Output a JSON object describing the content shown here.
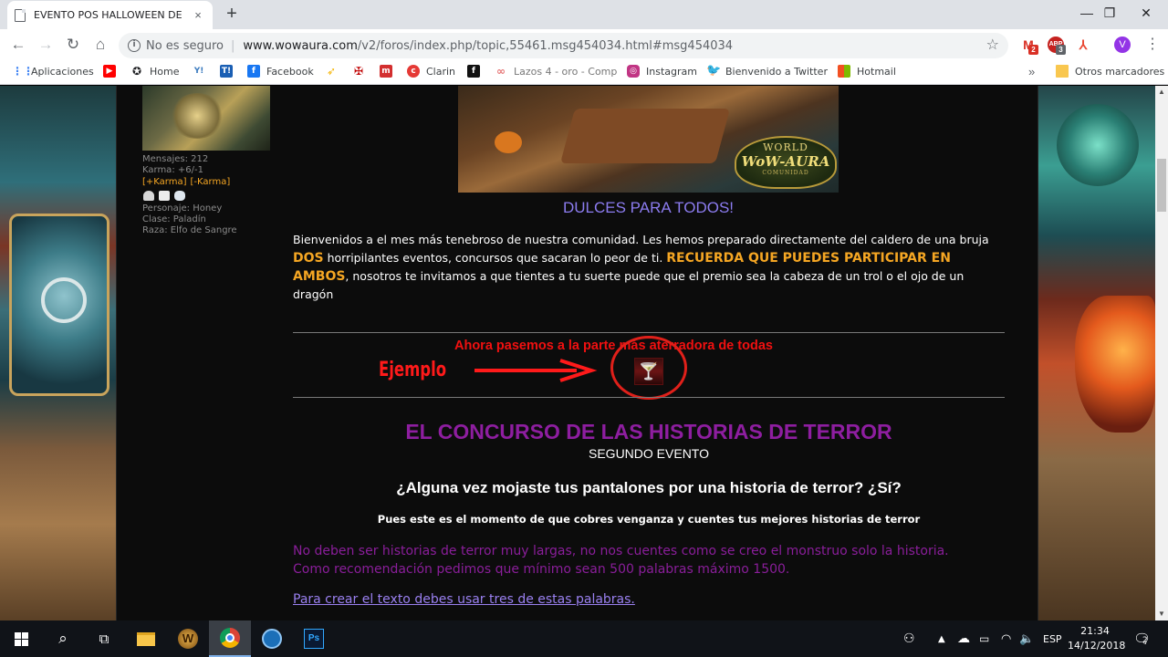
{
  "browser": {
    "tab_title": "EVENTO POS HALLOWEEN DE HI",
    "tab_close": "×",
    "new_tab": "+",
    "window_controls": [
      "—",
      "❐",
      "✕"
    ],
    "security_label": "No es seguro",
    "url_host": "www.wowaura.com",
    "url_path": "/v2/foros/index.php/topic,55461.msg454034.html#msg454034",
    "extensions": [
      {
        "icon": "gmail-icon",
        "badge": "2",
        "color": "#d93025"
      },
      {
        "icon": "abp-icon",
        "badge": "3",
        "color": "#c5221f"
      },
      {
        "icon": "acrobat-icon",
        "badge": "",
        "color": "#e94a35"
      }
    ],
    "avatar_letter": "V",
    "bookmarks": [
      {
        "label": "Aplicaciones",
        "icon": "apps-grid-icon",
        "color": "#4285f4"
      },
      {
        "label": "",
        "icon": "youtube-icon",
        "color": "#ff0000"
      },
      {
        "label": "Home",
        "icon": "home-icon",
        "color": "#202124"
      },
      {
        "label": "",
        "icon": "yahoo-icon",
        "color": "#3b7bbf"
      },
      {
        "label": "",
        "icon": "t-icon",
        "color": "#1a5fb4"
      },
      {
        "label": "Facebook",
        "icon": "facebook-icon",
        "color": "#1877f2"
      },
      {
        "label": "",
        "icon": "wing-icon",
        "color": "#f5b400"
      },
      {
        "label": "",
        "icon": "horde-icon",
        "color": "#c00000"
      },
      {
        "label": "",
        "icon": "m-icon",
        "color": "#d32f2f"
      },
      {
        "label": "Clarin",
        "icon": "clarin-icon",
        "color": "#e53935"
      },
      {
        "label": "",
        "icon": "f-icon",
        "color": "#111111"
      },
      {
        "label": "Lazos 4 - oro - Comp",
        "icon": "lazos-icon",
        "color": "#e57373"
      },
      {
        "label": "Instagram",
        "icon": "instagram-icon",
        "color": "#c13584"
      },
      {
        "label": "Bienvenido a Twitter",
        "icon": "twitter-icon",
        "color": "#1da1f2"
      },
      {
        "label": "Hotmail",
        "icon": "windows-icon",
        "color": "#f25022"
      }
    ],
    "bookmarks_more": "»",
    "other_bookmarks": "Otros marcadores"
  },
  "sidebar": {
    "mensajes": "Mensajes: 212",
    "karma": "Karma: +6/-1",
    "karma_plus": "[+Karma]",
    "karma_minus": "[-Karma]",
    "personaje": "Personaje: Honey",
    "clase": "Clase: Paladín",
    "raza": "Raza: Elfo de Sangre"
  },
  "banner": {
    "logo_line1": "WORLD",
    "logo_line2": "WoW-AURA",
    "logo_line3": "COMUNIDAD"
  },
  "post": {
    "dulces": "DULCES PARA TODOS!",
    "intro_1": "Bienvenidos a el mes más tenebroso de nuestra comunidad. Les hemos preparado directamente del caldero de una bruja",
    "intro_dos": "DOS",
    "intro_2": " horripilantes eventos, concursos que sacaran lo peor de ti. ",
    "intro_recuerda": "RECUERDA QUE PUEDES PARTICIPAR EN AMBOS",
    "intro_3": ", nosotros te invitamos a que tientes a tu suerte puede que el premio sea la cabeza de un trol o el ojo de un dragón",
    "ahora": "Ahora pasemos a la parte más aterradora de todas",
    "ejemplo": "Ejemplo",
    "concurso_title": "EL CONCURSO DE LAS HISTORIAS DE TERROR",
    "segundo": "SEGUNDO EVENTO",
    "pregunta": "¿Alguna vez mojaste tus pantalones por una historia de terror? ¿Sí?",
    "pues": "Pues este es el momento de que cobres venganza y cuentes tus mejores historias de terror",
    "no_deben": "No deben ser historias de terror muy largas, no nos cuentes como se creo el monstruo solo la historia.",
    "recomendacion": "Como recomendación pedimos que mínimo sean 500 palabras máximo 1500.",
    "link": "Para crear el texto debes usar tres de estas palabras."
  },
  "taskbar": {
    "apps": [
      "start-icon",
      "search-icon",
      "task-view-icon",
      "file-explorer-icon",
      "wow-icon",
      "chrome-icon",
      "battlenet-icon",
      "photoshop-icon"
    ],
    "language": "ESP",
    "time": "21:34",
    "date": "14/12/2018",
    "notification_count": "2"
  }
}
